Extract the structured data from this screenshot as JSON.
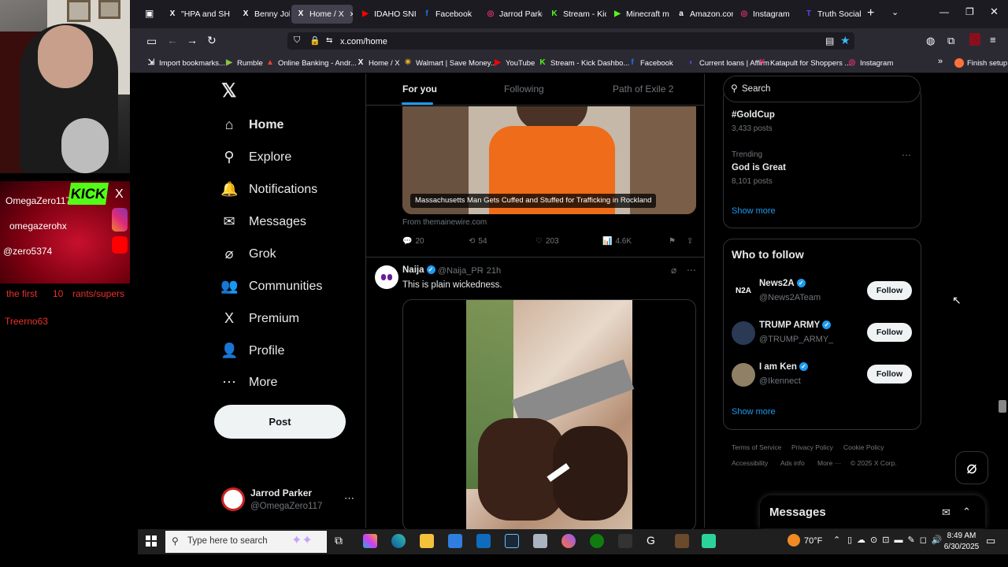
{
  "overlay": {
    "user1": "OmegaZero117",
    "user2": "omegazerohx",
    "user3": "@zero5374",
    "kick_label": "KICK",
    "x_label": "X",
    "line1_a": "the first",
    "line1_b": "10",
    "line1_c": "rants/supers",
    "line2": "Treerno63"
  },
  "browser": {
    "tabs": [
      {
        "label": "\"HPA and SH",
        "icon": "X",
        "color": "#ffffff"
      },
      {
        "label": "Benny Johns",
        "icon": "X",
        "color": "#ffffff"
      },
      {
        "label": "Home / X",
        "icon": "X",
        "color": "#ffffff"
      },
      {
        "label": "IDAHO SNIP",
        "icon": "▶",
        "color": "#ff0000"
      },
      {
        "label": "Facebook",
        "icon": "f",
        "color": "#1877f2"
      },
      {
        "label": "Jarrod Parke",
        "icon": "◎",
        "color": "#e1306c"
      },
      {
        "label": "Stream - Kick",
        "icon": "K",
        "color": "#53fc18"
      },
      {
        "label": "Minecraft mo",
        "icon": "▶",
        "color": "#53fc18"
      },
      {
        "label": "Amazon.com",
        "icon": "a",
        "color": "#ffffff"
      },
      {
        "label": "Instagram",
        "icon": "◎",
        "color": "#e1306c"
      },
      {
        "label": "Truth Social",
        "icon": "T",
        "color": "#5448ee"
      }
    ],
    "url": "x.com/home",
    "bookmarks": [
      {
        "label": "Import bookmarks...",
        "icon": "⇲",
        "color": "#fbfbfe"
      },
      {
        "label": "Rumble",
        "icon": "▶",
        "color": "#85c742"
      },
      {
        "label": "Online Banking - Andr...",
        "icon": "▲",
        "color": "#e8452c"
      },
      {
        "label": "Home / X",
        "icon": "X",
        "color": "#ffffff"
      },
      {
        "label": "Walmart | Save Money...",
        "icon": "✳",
        "color": "#ffc220"
      },
      {
        "label": "YouTube",
        "icon": "▶",
        "color": "#ff0000"
      },
      {
        "label": "Stream - Kick Dashbo...",
        "icon": "K",
        "color": "#53fc18"
      },
      {
        "label": "Facebook",
        "icon": "f",
        "color": "#1877f2"
      },
      {
        "label": "Current loans | Affirm",
        "icon": "◐",
        "color": "#4a4af4"
      },
      {
        "label": "Katapult for Shoppers ...",
        "icon": "K",
        "color": "#e0306b"
      },
      {
        "label": "Instagram",
        "icon": "◎",
        "color": "#e1306c"
      }
    ],
    "finish_setup": "Finish setup"
  },
  "nav": {
    "items": [
      {
        "label": "Home",
        "icon": "⌂"
      },
      {
        "label": "Explore",
        "icon": "⚲"
      },
      {
        "label": "Notifications",
        "icon": "🔔"
      },
      {
        "label": "Messages",
        "icon": "✉"
      },
      {
        "label": "Grok",
        "icon": "⌀"
      },
      {
        "label": "Communities",
        "icon": "👥"
      },
      {
        "label": "Premium",
        "icon": "X"
      },
      {
        "label": "Profile",
        "icon": "👤"
      },
      {
        "label": "More",
        "icon": "⋯"
      }
    ],
    "post_label": "Post",
    "account_name": "Jarrod Parker",
    "account_handle": "@OmegaZero117"
  },
  "feed": {
    "tabs": [
      "For you",
      "Following",
      "Path of Exile 2"
    ],
    "post1": {
      "caption": "Massachusetts Man Gets Cuffed and Stuffed for Trafficking in Rockland",
      "source": "From themainewire.com",
      "replies": "20",
      "reposts": "54",
      "likes": "203",
      "views": "4.6K"
    },
    "post2": {
      "name": "Naija",
      "handle": "@Naija_PR",
      "time": "· 21h",
      "text": "This is plain wickedness."
    }
  },
  "sidebar": {
    "search_placeholder": "Search",
    "trend1": {
      "name": "#GoldCup",
      "posts": "3,433 posts"
    },
    "trend2": {
      "label": "Trending",
      "name": "God is Great",
      "posts": "8,101 posts"
    },
    "show_more": "Show more",
    "who_to_follow": "Who to follow",
    "follows": [
      {
        "name": "News2A",
        "handle": "@News2ATeam",
        "button": "Follow"
      },
      {
        "name": "TRUMP ARMY",
        "handle": "@TRUMP_ARMY_",
        "button": "Follow"
      },
      {
        "name": "I am Ken",
        "handle": "@Ikennect",
        "button": "Follow"
      }
    ],
    "show_more2": "Show more",
    "footer": [
      "Terms of Service",
      "Privacy Policy",
      "Cookie Policy",
      "Accessibility",
      "Ads info",
      "More ···",
      "© 2025 X Corp."
    ],
    "news2a_logo": "N2A",
    "messages": "Messages"
  },
  "taskbar": {
    "search_placeholder": "Type here to search",
    "weather": "70°F",
    "time": "8:49 AM",
    "date": "6/30/2025"
  }
}
